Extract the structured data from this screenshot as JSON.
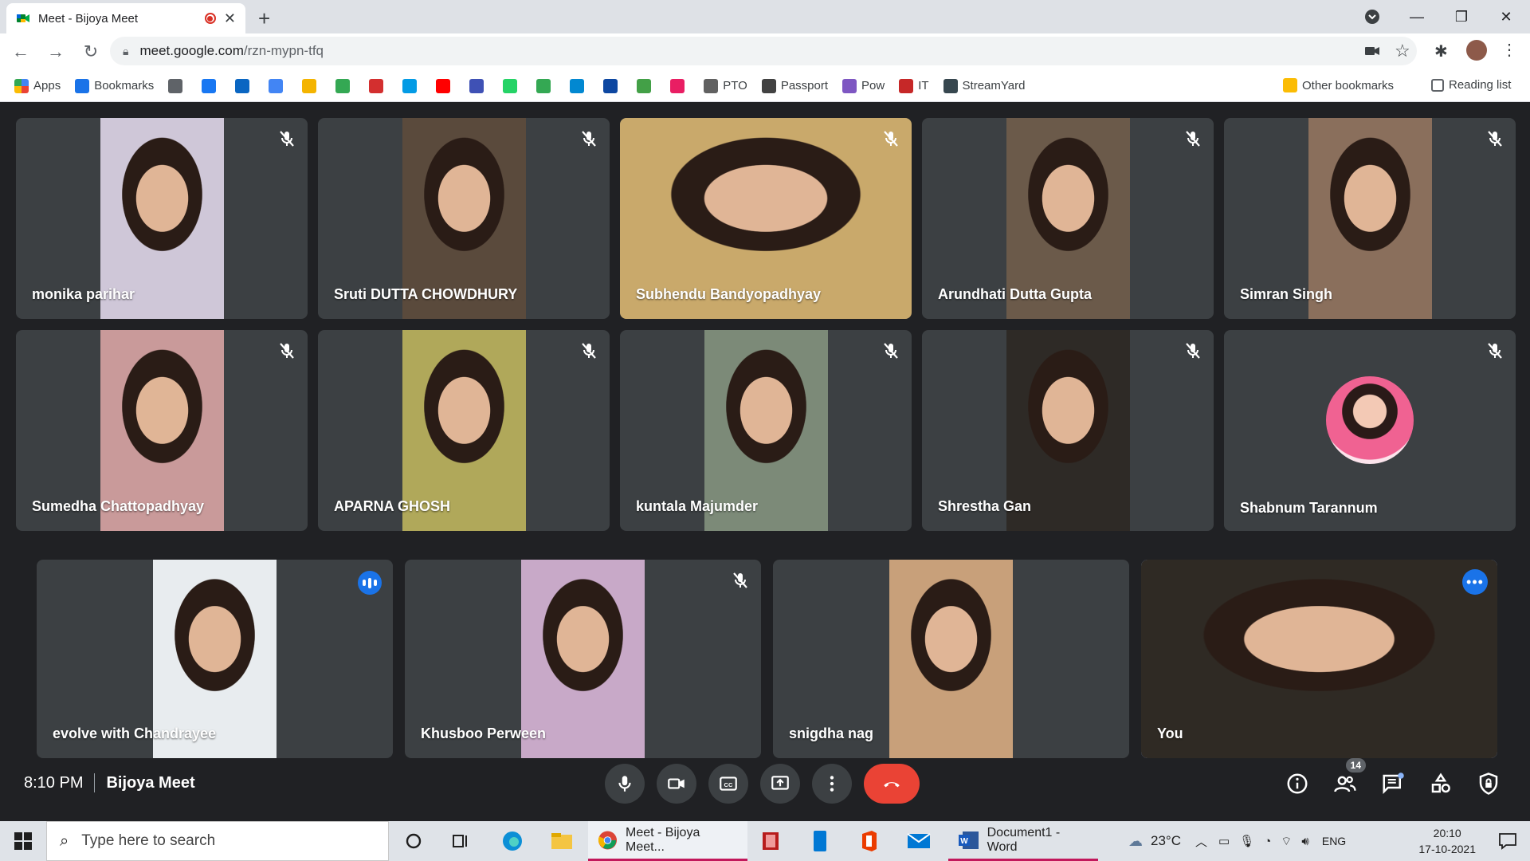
{
  "browser": {
    "tab_title": "Meet - Bijoya Meet",
    "url_host": "meet.google.com",
    "url_path": "/rzn-mypn-tfq",
    "bookmarks": [
      {
        "label": "Apps",
        "color": "#4285f4"
      },
      {
        "label": "Bookmarks",
        "color": "#1a73e8"
      },
      {
        "label": "",
        "color": "#5f6368"
      },
      {
        "label": "",
        "color": "#1877f2"
      },
      {
        "label": "",
        "color": "#0a66c2"
      },
      {
        "label": "",
        "color": "#4285f4"
      },
      {
        "label": "",
        "color": "#f4b400"
      },
      {
        "label": "",
        "color": "#34a853"
      },
      {
        "label": "",
        "color": "#d32f2f"
      },
      {
        "label": "",
        "color": "#039be5"
      },
      {
        "label": "",
        "color": "#ff0000"
      },
      {
        "label": "",
        "color": "#3f51b5"
      },
      {
        "label": "",
        "color": "#25d366"
      },
      {
        "label": "",
        "color": "#34a853"
      },
      {
        "label": "",
        "color": "#0288d1"
      },
      {
        "label": "",
        "color": "#0d47a1"
      },
      {
        "label": "",
        "color": "#43a047"
      },
      {
        "label": "",
        "color": "#e91e63"
      },
      {
        "label": "PTO",
        "color": "#616161"
      },
      {
        "label": "Passport",
        "color": "#424242"
      },
      {
        "label": "Pow",
        "color": "#7e57c2"
      },
      {
        "label": "IT",
        "color": "#c62828"
      },
      {
        "label": "StreamYard",
        "color": "#37474f"
      }
    ],
    "other_bookmarks": "Other bookmarks",
    "reading_list": "Reading list"
  },
  "participants_row1": [
    {
      "name": "monika parihar",
      "bg": "#cfc7d8",
      "muted": true
    },
    {
      "name": "Sruti DUTTA CHOWDHURY",
      "bg": "#5a4a3c",
      "muted": true
    },
    {
      "name": "Subhendu Bandyopadhyay",
      "bg": "#c9a96b",
      "muted": true
    },
    {
      "name": "Arundhati Dutta Gupta",
      "bg": "#6b5a4a",
      "muted": true
    },
    {
      "name": "Simran Singh",
      "bg": "#8a6f5c",
      "muted": true
    }
  ],
  "participants_row2": [
    {
      "name": "Sumedha Chattopadhyay",
      "bg": "#c99a9a",
      "muted": true
    },
    {
      "name": "APARNA GHOSH",
      "bg": "#b0a85a",
      "muted": true
    },
    {
      "name": "kuntala Majumder",
      "bg": "#7c8a78",
      "muted": true
    },
    {
      "name": "Shrestha Gan",
      "bg": "#2e2a26",
      "muted": true
    },
    {
      "name": "Shabnum Tarannum",
      "bg": "",
      "muted": true,
      "avatar": true
    }
  ],
  "participants_row3": [
    {
      "name": "evolve with Chandrayee",
      "bg": "#e8ecef",
      "speaking": true
    },
    {
      "name": "Khusboo Perween",
      "bg": "#c8a9c8",
      "muted": true
    },
    {
      "name": "snigdha nag",
      "bg": "#c8a07a",
      "muted": false
    },
    {
      "name": "You",
      "bg": "#2f2a24",
      "self": true
    }
  ],
  "meeting": {
    "time": "8:10 PM",
    "name": "Bijoya Meet",
    "participant_count": "14"
  },
  "taskbar": {
    "search_placeholder": "Type here to search",
    "meet_app": "Meet - Bijoya Meet...",
    "word_app": "Document1 - Word",
    "temperature": "23°C",
    "language": "ENG",
    "time": "20:10",
    "date": "17-10-2021"
  }
}
